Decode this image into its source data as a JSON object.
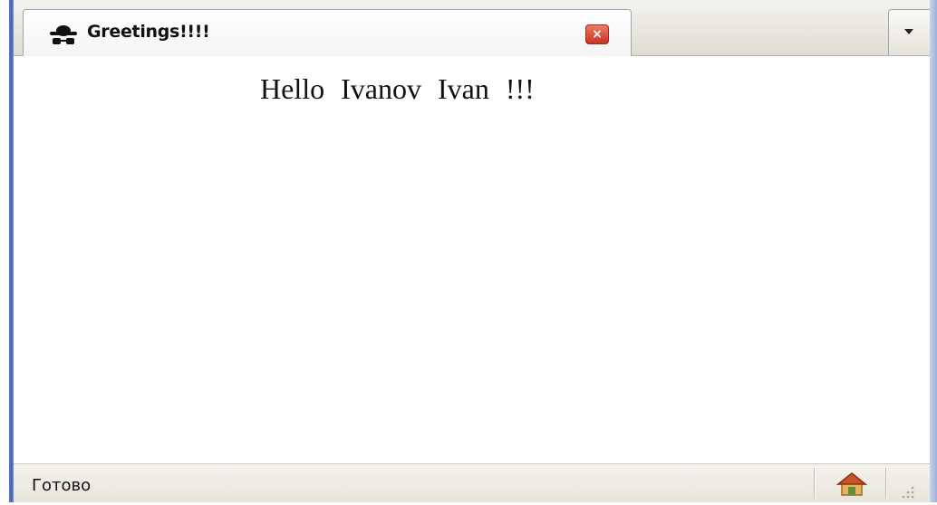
{
  "tab": {
    "title": "Greetings!!!!",
    "icon": "spy-hat-icon",
    "close_glyph": "×",
    "close_color": "#d2402c"
  },
  "content": {
    "greeting": "Hello  Ivanov  Ivan !!!"
  },
  "status": {
    "text": "Готово",
    "home_icon": "home-icon"
  }
}
